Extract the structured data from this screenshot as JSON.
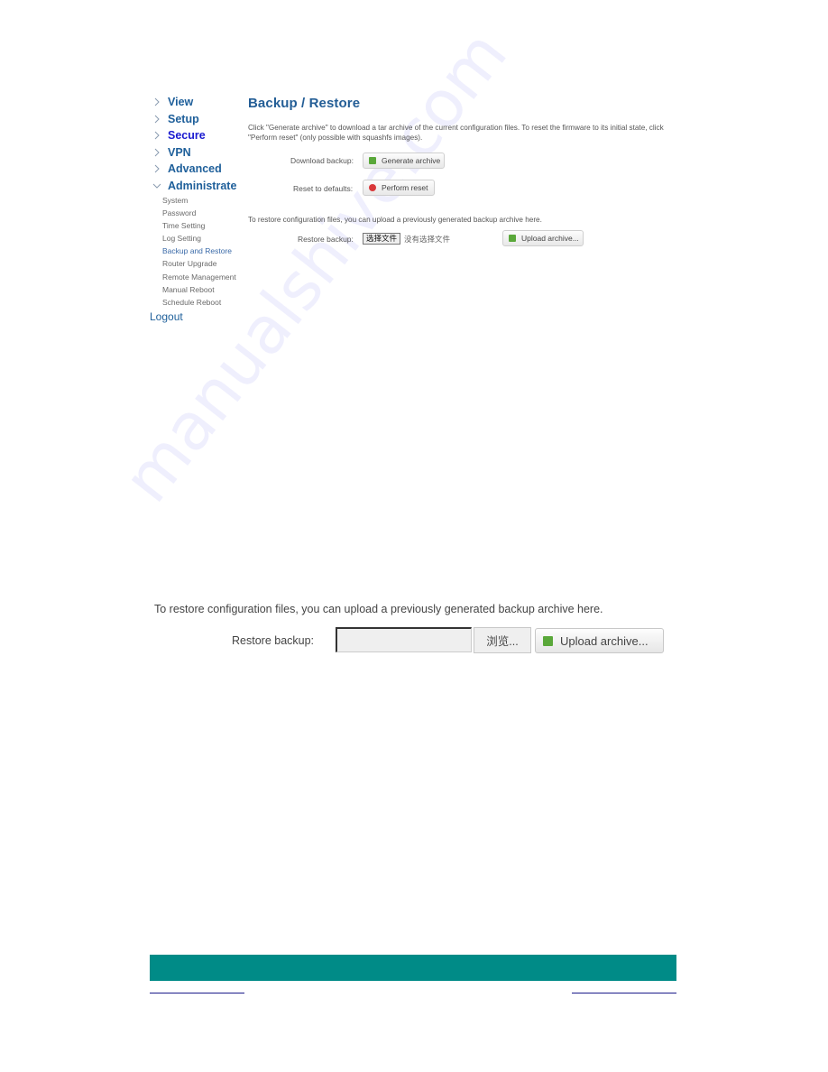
{
  "sidebar": {
    "top_items": [
      {
        "label": "View",
        "icon": "chevron-right-icon",
        "expanded": false,
        "active": false
      },
      {
        "label": "Setup",
        "icon": "chevron-right-icon",
        "expanded": false,
        "active": false
      },
      {
        "label": "Secure",
        "icon": "chevron-right-icon",
        "expanded": false,
        "active": true
      },
      {
        "label": "VPN",
        "icon": "chevron-right-icon",
        "expanded": false,
        "active": false
      },
      {
        "label": "Advanced",
        "icon": "chevron-right-icon",
        "expanded": false,
        "active": false
      },
      {
        "label": "Administrate",
        "icon": "chevron-down-icon",
        "expanded": true,
        "active": false
      }
    ],
    "sub_items": [
      {
        "label": "System"
      },
      {
        "label": "Password"
      },
      {
        "label": "Time Setting"
      },
      {
        "label": "Log Setting"
      },
      {
        "label": "Backup and Restore",
        "active": true
      },
      {
        "label": "Router Upgrade"
      },
      {
        "label": "Remote Management"
      },
      {
        "label": "Manual Reboot"
      },
      {
        "label": "Schedule Reboot"
      }
    ],
    "logout_label": "Logout"
  },
  "main": {
    "title": "Backup / Restore",
    "description": "Click \"Generate archive\" to download a tar archive of the current configuration files. To reset the firmware to its initial state, click \"Perform reset\" (only possible with squashfs images).",
    "download_backup": {
      "label": "Download backup:",
      "button": "Generate archive",
      "icon": "download-icon"
    },
    "reset_defaults": {
      "label": "Reset to defaults:",
      "button": "Perform reset",
      "icon": "reset-icon"
    },
    "restore_description": "To restore configuration files, you can upload a previously generated backup archive here.",
    "restore_backup": {
      "label": "Restore backup:",
      "choose_file_button": "选择文件",
      "no_file_text": "没有选择文件",
      "upload_button": "Upload archive...",
      "icon": "upload-icon"
    }
  },
  "inset": {
    "restore_description": "To restore configuration files, you can upload a previously generated backup archive here.",
    "restore_label": "Restore backup:",
    "file_input_value": "",
    "browse_button": "浏览...",
    "upload_button": "Upload archive..."
  },
  "watermark": "manualshive.com",
  "colors": {
    "accent": "#1e5f9a",
    "active_nav": "#1a1ad0",
    "footer_band": "#008b87",
    "footer_rule": "#1a1a8a"
  }
}
